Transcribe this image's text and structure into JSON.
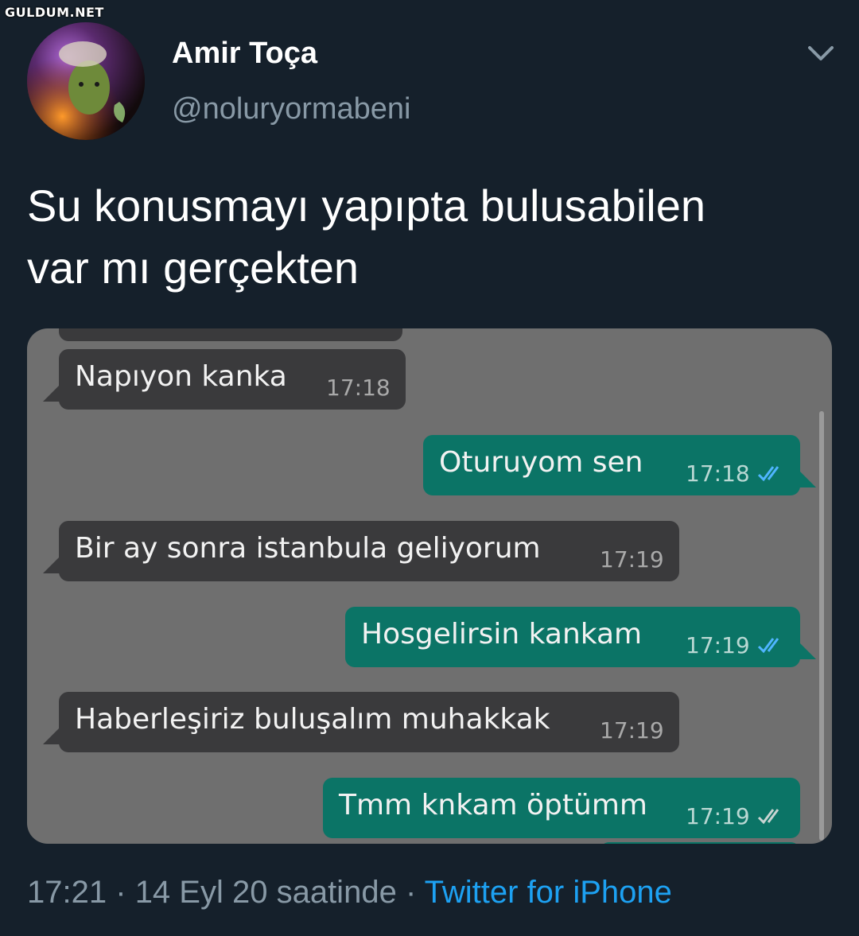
{
  "watermark": "GULDUM.NET",
  "tweet": {
    "display_name": "Amir Toça",
    "handle": "@noluryormabeni",
    "text_line1": "Su konusmayı yapıpta bulusabilen",
    "text_line2": "var mı gerçekten",
    "time": "17:21",
    "separator": "·",
    "date": "14 Eyl 20 saatinde",
    "source": "Twitter for iPhone"
  },
  "chat": {
    "messages": [
      {
        "direction": "in",
        "text": "Napıyon kanka",
        "time": "17:18"
      },
      {
        "direction": "out",
        "text": "Oturuyom sen",
        "time": "17:18",
        "read": true
      },
      {
        "direction": "in",
        "text": "Bir ay sonra istanbula geliyorum",
        "time": "17:19"
      },
      {
        "direction": "out",
        "text": "Hosgelirsin kankam",
        "time": "17:19",
        "read": true
      },
      {
        "direction": "in",
        "text": "Haberleşiriz buluşalım muhakkak",
        "time": "17:19"
      },
      {
        "direction": "out",
        "text": "Tmm knkam öptümm",
        "time": "17:19",
        "read": false
      }
    ]
  },
  "colors": {
    "background": "#15202b",
    "secondary_text": "#8899a6",
    "link": "#1da1f2",
    "incoming_bubble": "#3a3a3c",
    "outgoing_bubble": "#0b7466",
    "read_tick": "#4fb5ff"
  },
  "icons": {
    "menu": "chevron-down-icon",
    "receipt": "double-check-icon"
  }
}
